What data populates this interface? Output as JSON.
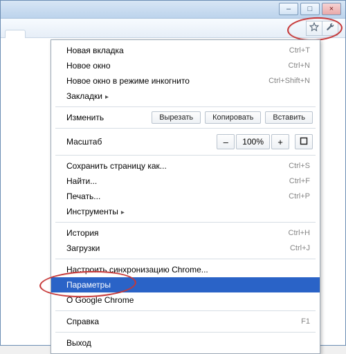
{
  "window_controls": {
    "minimize": "–",
    "maximize": "□",
    "close": "×"
  },
  "toolbar": {
    "star_icon": "star-icon",
    "wrench_icon": "wrench-icon"
  },
  "menu": {
    "new_tab": {
      "label": "Новая вкладка",
      "shortcut": "Ctrl+T"
    },
    "new_window": {
      "label": "Новое окно",
      "shortcut": "Ctrl+N"
    },
    "incognito": {
      "label": "Новое окно в режиме инкогнито",
      "shortcut": "Ctrl+Shift+N"
    },
    "bookmarks": {
      "label": "Закладки"
    },
    "edit_label": "Изменить",
    "edit_cut": "Вырезать",
    "edit_copy": "Копировать",
    "edit_paste": "Вставить",
    "zoom_label": "Масштаб",
    "zoom_minus": "–",
    "zoom_value": "100%",
    "zoom_plus": "+",
    "save_page": {
      "label": "Сохранить страницу как...",
      "shortcut": "Ctrl+S"
    },
    "find": {
      "label": "Найти...",
      "shortcut": "Ctrl+F"
    },
    "print": {
      "label": "Печать...",
      "shortcut": "Ctrl+P"
    },
    "tools": {
      "label": "Инструменты"
    },
    "history": {
      "label": "История",
      "shortcut": "Ctrl+H"
    },
    "downloads": {
      "label": "Загрузки",
      "shortcut": "Ctrl+J"
    },
    "sync": {
      "label": "Настроить синхронизацию Chrome..."
    },
    "options": {
      "label": "Параметры"
    },
    "about": {
      "label": "О Google Chrome"
    },
    "help": {
      "label": "Справка",
      "shortcut": "F1"
    },
    "exit": {
      "label": "Выход"
    }
  }
}
